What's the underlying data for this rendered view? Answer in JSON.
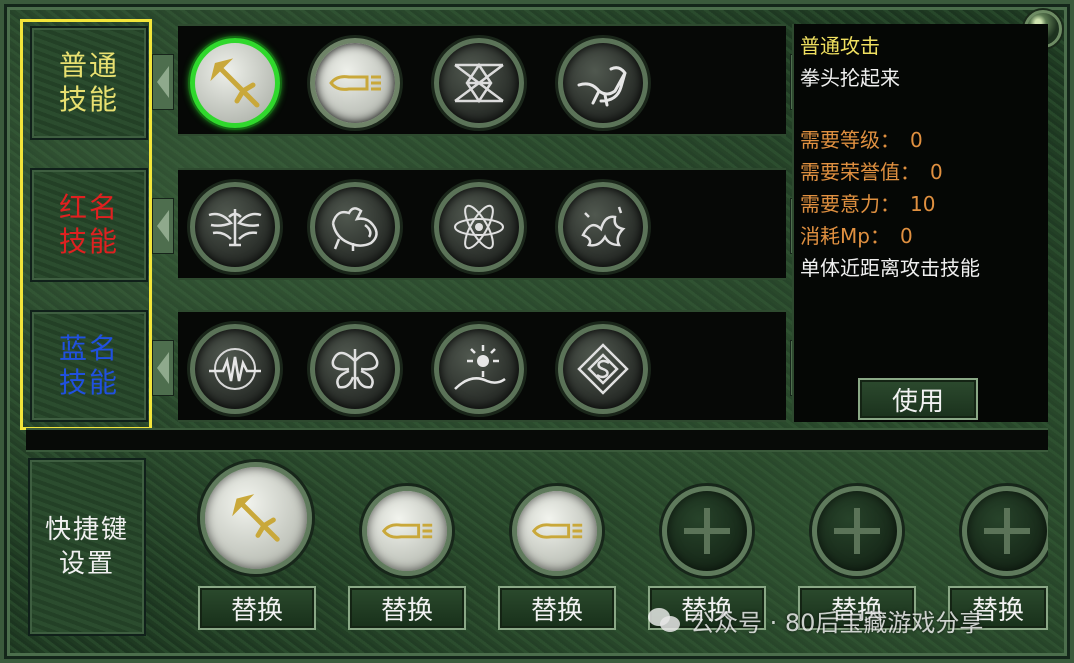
{
  "categories": [
    {
      "line1": "普通",
      "line2": "技能",
      "color": "#e8e070"
    },
    {
      "line1": "红名",
      "line2": "技能",
      "color": "#e02020"
    },
    {
      "line1": "蓝名",
      "line2": "技能",
      "color": "#2050e0"
    }
  ],
  "skills": {
    "normal": [
      "sword-icon",
      "bullet-icon",
      "cross-rune-icon",
      "bird-icon"
    ],
    "red": [
      "winged-figure-icon",
      "dragon-icon",
      "atom-icon",
      "flower-icon"
    ],
    "blue": [
      "vortex-icon",
      "butterfly-rune-icon",
      "sunrise-icon",
      "dollar-rune-icon"
    ]
  },
  "info": {
    "name": "普通攻击",
    "description": "拳头抡起来",
    "req_level_label": "需要等级：",
    "req_level": "0",
    "req_honor_label": "需要荣誉值：",
    "req_honor": "0",
    "req_will_label": "需要意力：",
    "req_will": "10",
    "mp_cost_label": "消耗Mp：",
    "mp_cost": "0",
    "type_desc": "单体近距离攻击技能"
  },
  "use_button": "使用",
  "hotkey": {
    "label_line1": "快捷键",
    "label_line2": "设置",
    "swap_label": "替换",
    "slots": [
      "sword-icon",
      "bullet-icon",
      "bullet-icon",
      "empty-plus-icon",
      "empty-plus-icon",
      "empty-plus-icon"
    ]
  },
  "watermark": "公众号 · 80后宝藏游戏分享",
  "colors": {
    "selected_ring": "#2fd82c",
    "highlight_box": "#f2e53a"
  }
}
